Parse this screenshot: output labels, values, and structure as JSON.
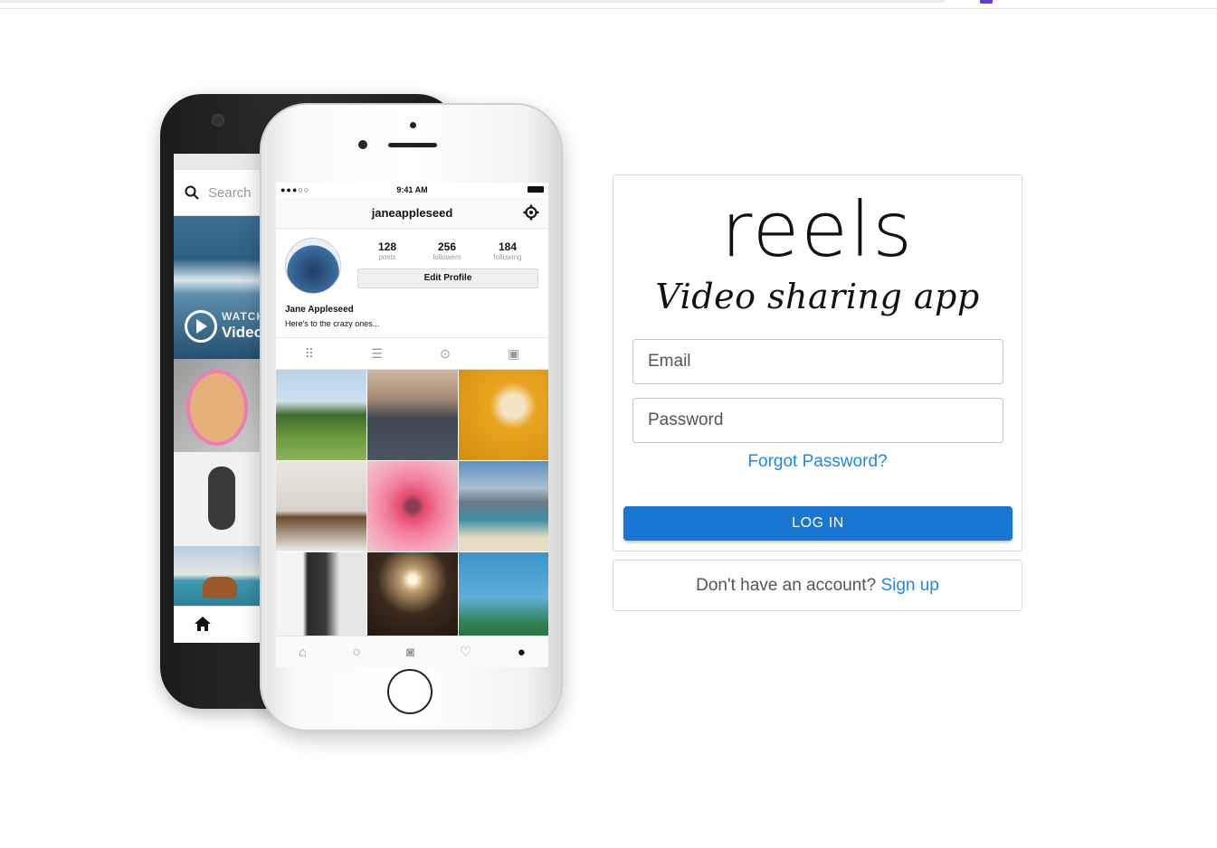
{
  "colors": {
    "primary": "#1976d2",
    "link": "#1e88e5",
    "border": "#dbdbdb"
  },
  "brand": {
    "logo": "reels",
    "tagline": "Video sharing app"
  },
  "login": {
    "email_placeholder": "Email",
    "password_placeholder": "Password",
    "forgot_password": "Forgot Password?",
    "login_button": "LOG IN"
  },
  "signup": {
    "prompt": "Don't have an account?",
    "link": "Sign up"
  },
  "mockup": {
    "back_phone": {
      "search_placeholder": "Search",
      "watch_label": "WATCH",
      "video_label": "Video"
    },
    "front_phone": {
      "time": "9:41 AM",
      "username": "janeappleseed",
      "stats": [
        {
          "value": "128",
          "label": "posts"
        },
        {
          "value": "256",
          "label": "followers"
        },
        {
          "value": "184",
          "label": "following"
        }
      ],
      "edit_profile": "Edit Profile",
      "full_name": "Jane Appleseed",
      "bio": "Here's to the crazy ones..."
    }
  }
}
